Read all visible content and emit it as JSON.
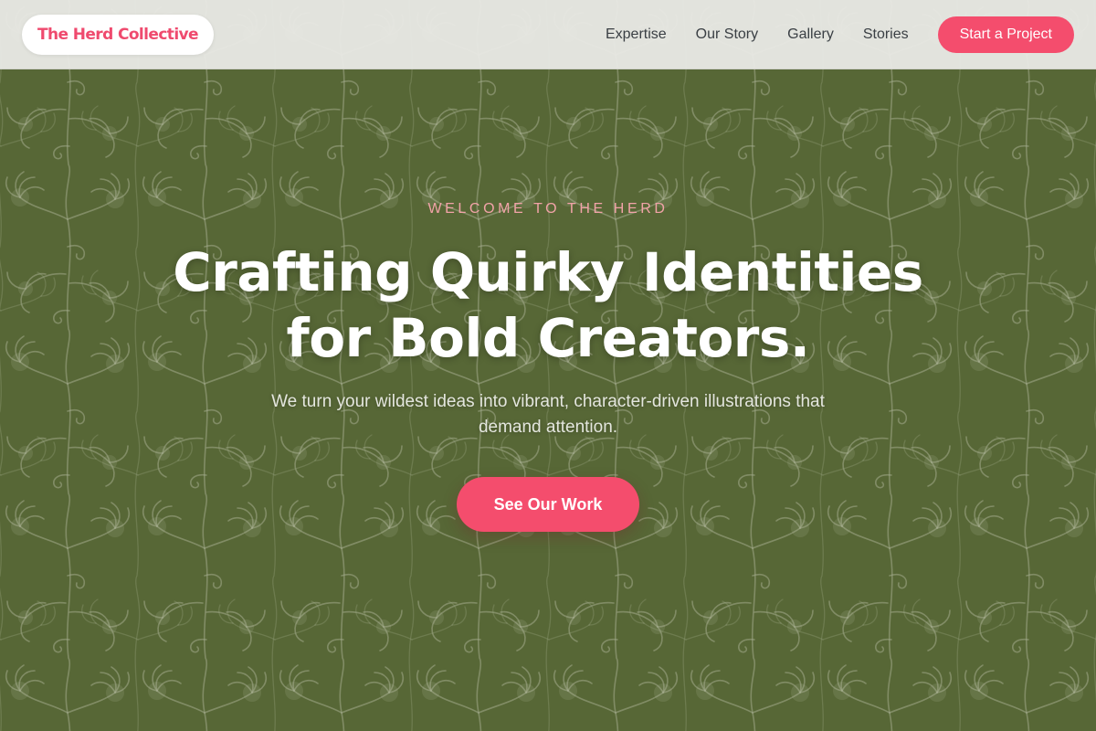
{
  "brand": {
    "name": "The Herd Collective",
    "accent_color": "#f44d6d",
    "background_color": "#5d6e3c"
  },
  "nav": {
    "links": [
      "Expertise",
      "Our Story",
      "Gallery",
      "Stories"
    ],
    "cta_label": "Start a Project"
  },
  "hero": {
    "eyebrow": "WELCOME TO THE HERD",
    "headline_line1": "Crafting Quirky Identities",
    "headline_line2": "for Bold Creators.",
    "subtitle": "We turn your wildest ideas into vibrant, character-driven illustrations that demand attention.",
    "button_label": "See Our Work",
    "background_icon": "botanical-leaf-pattern-icon"
  }
}
